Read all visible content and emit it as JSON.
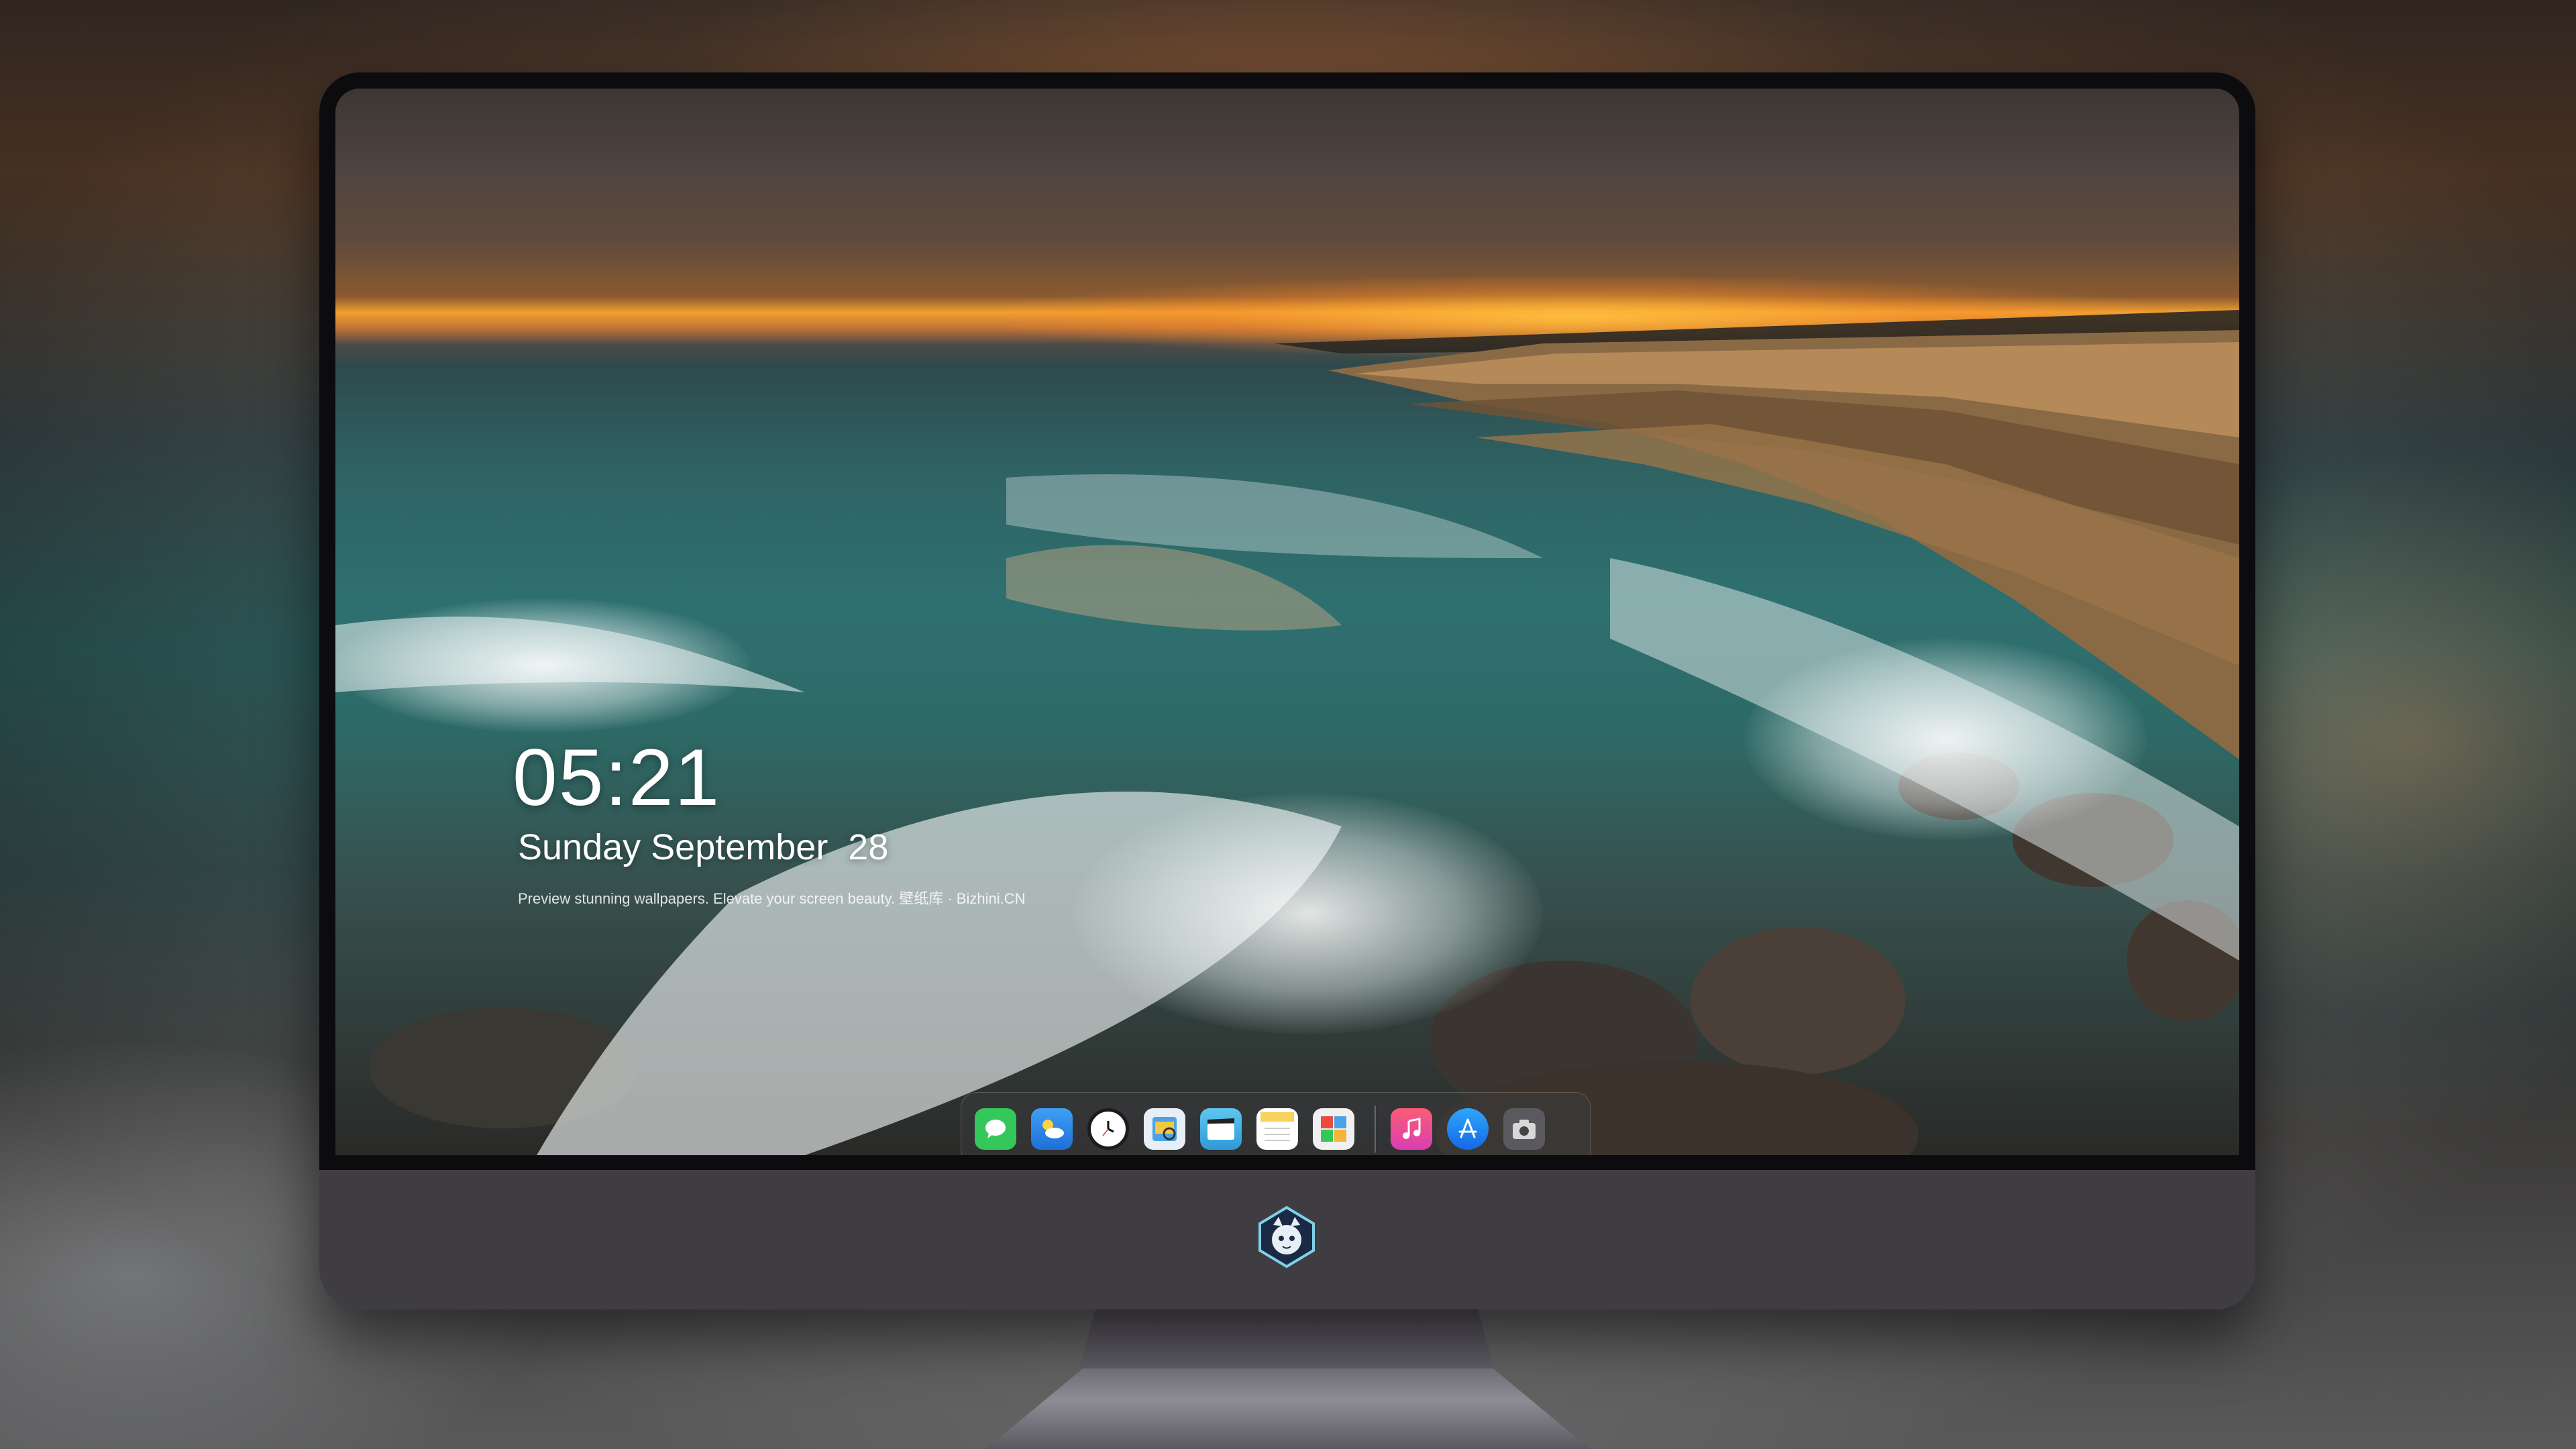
{
  "lockscreen": {
    "time": "05:21",
    "date": "Sunday September  28",
    "tagline": "Preview stunning wallpapers. Elevate your screen beauty. 壁纸库 · Bizhini.CN"
  },
  "dock": {
    "apps": [
      {
        "name": "Messages",
        "icon": "messages-icon",
        "color": "#34c759"
      },
      {
        "name": "Weather",
        "icon": "weather-icon",
        "color": "#2f8cf0"
      },
      {
        "name": "Clock",
        "icon": "clock-icon",
        "color": "#1c1c1e"
      },
      {
        "name": "Preview",
        "icon": "preview-icon",
        "color": "#4aa3e8"
      },
      {
        "name": "Clips",
        "icon": "clips-icon",
        "color": "#49b7e8"
      },
      {
        "name": "Notes",
        "icon": "notes-icon",
        "color": "#f6d35b"
      },
      {
        "name": "Photo Booth",
        "icon": "photo-booth-icon",
        "color": "#e8e8e8"
      },
      {
        "name": "Music",
        "icon": "music-icon",
        "color": "#f53c8b"
      },
      {
        "name": "App Store",
        "icon": "app-store-icon",
        "color": "#1e8ef5"
      },
      {
        "name": "Screenshot",
        "icon": "screenshot-icon",
        "color": "#4a4a4e"
      }
    ]
  },
  "colors": {
    "monitor_chin": "#3e3b40",
    "bezel": "#0c0c0e",
    "sunset": "#f2a030"
  }
}
